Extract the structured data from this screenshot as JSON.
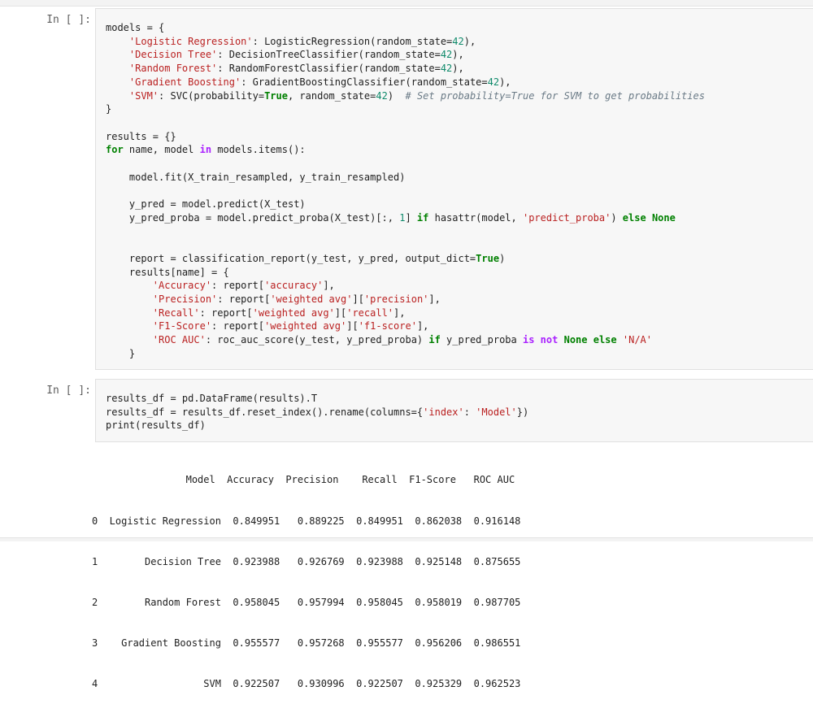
{
  "cells": [
    {
      "prompt": "In [ ]:",
      "code_lines": [
        [
          [
            "t",
            "models = {"
          ]
        ],
        [
          [
            "t",
            "    "
          ],
          [
            "s",
            "'Logistic Regression'"
          ],
          [
            "t",
            ": LogisticRegression(random_state="
          ],
          [
            "n",
            "42"
          ],
          [
            "t",
            "),"
          ]
        ],
        [
          [
            "t",
            "    "
          ],
          [
            "s",
            "'Decision Tree'"
          ],
          [
            "t",
            ": DecisionTreeClassifier(random_state="
          ],
          [
            "n",
            "42"
          ],
          [
            "t",
            "),"
          ]
        ],
        [
          [
            "t",
            "    "
          ],
          [
            "s",
            "'Random Forest'"
          ],
          [
            "t",
            ": RandomForestClassifier(random_state="
          ],
          [
            "n",
            "42"
          ],
          [
            "t",
            "),"
          ]
        ],
        [
          [
            "t",
            "    "
          ],
          [
            "s",
            "'Gradient Boosting'"
          ],
          [
            "t",
            ": GradientBoostingClassifier(random_state="
          ],
          [
            "n",
            "42"
          ],
          [
            "t",
            "),"
          ]
        ],
        [
          [
            "t",
            "    "
          ],
          [
            "s",
            "'SVM'"
          ],
          [
            "t",
            ": SVC(probability="
          ],
          [
            "k",
            "True"
          ],
          [
            "t",
            ", random_state="
          ],
          [
            "n",
            "42"
          ],
          [
            "t",
            ")  "
          ],
          [
            "c",
            "# Set probability=True for SVM to get probabilities"
          ]
        ],
        [
          [
            "t",
            "}"
          ]
        ],
        [
          [
            "t",
            ""
          ]
        ],
        [
          [
            "t",
            "results = {}"
          ]
        ],
        [
          [
            "k",
            "for"
          ],
          [
            "t",
            " name, model "
          ],
          [
            "o",
            "in"
          ],
          [
            "t",
            " models.items():"
          ]
        ],
        [
          [
            "t",
            ""
          ]
        ],
        [
          [
            "t",
            "    model.fit(X_train_resampled, y_train_resampled)"
          ]
        ],
        [
          [
            "t",
            ""
          ]
        ],
        [
          [
            "t",
            "    y_pred = model.predict(X_test)"
          ]
        ],
        [
          [
            "t",
            "    y_pred_proba = model.predict_proba(X_test)[:, "
          ],
          [
            "n",
            "1"
          ],
          [
            "t",
            "] "
          ],
          [
            "k",
            "if"
          ],
          [
            "t",
            " hasattr(model, "
          ],
          [
            "s",
            "'predict_proba'"
          ],
          [
            "t",
            ") "
          ],
          [
            "k",
            "else"
          ],
          [
            "t",
            " "
          ],
          [
            "k",
            "None"
          ]
        ],
        [
          [
            "t",
            ""
          ]
        ],
        [
          [
            "t",
            ""
          ]
        ],
        [
          [
            "t",
            "    report = classification_report(y_test, y_pred, output_dict="
          ],
          [
            "k",
            "True"
          ],
          [
            "t",
            ")"
          ]
        ],
        [
          [
            "t",
            "    results[name] = {"
          ]
        ],
        [
          [
            "t",
            "        "
          ],
          [
            "s",
            "'Accuracy'"
          ],
          [
            "t",
            ": report["
          ],
          [
            "s",
            "'accuracy'"
          ],
          [
            "t",
            "],"
          ]
        ],
        [
          [
            "t",
            "        "
          ],
          [
            "s",
            "'Precision'"
          ],
          [
            "t",
            ": report["
          ],
          [
            "s",
            "'weighted avg'"
          ],
          [
            "t",
            "]["
          ],
          [
            "s",
            "'precision'"
          ],
          [
            "t",
            "],"
          ]
        ],
        [
          [
            "t",
            "        "
          ],
          [
            "s",
            "'Recall'"
          ],
          [
            "t",
            ": report["
          ],
          [
            "s",
            "'weighted avg'"
          ],
          [
            "t",
            "]["
          ],
          [
            "s",
            "'recall'"
          ],
          [
            "t",
            "],"
          ]
        ],
        [
          [
            "t",
            "        "
          ],
          [
            "s",
            "'F1-Score'"
          ],
          [
            "t",
            ": report["
          ],
          [
            "s",
            "'weighted avg'"
          ],
          [
            "t",
            "]["
          ],
          [
            "s",
            "'f1-score'"
          ],
          [
            "t",
            "],"
          ]
        ],
        [
          [
            "t",
            "        "
          ],
          [
            "s",
            "'ROC AUC'"
          ],
          [
            "t",
            ": roc_auc_score(y_test, y_pred_proba) "
          ],
          [
            "k",
            "if"
          ],
          [
            "t",
            " y_pred_proba "
          ],
          [
            "o",
            "is"
          ],
          [
            "t",
            " "
          ],
          [
            "o",
            "not"
          ],
          [
            "t",
            " "
          ],
          [
            "k",
            "None"
          ],
          [
            "t",
            " "
          ],
          [
            "k",
            "else"
          ],
          [
            "t",
            " "
          ],
          [
            "s",
            "'N/A'"
          ]
        ],
        [
          [
            "t",
            "    }"
          ]
        ]
      ]
    },
    {
      "prompt": "In [ ]:",
      "code_lines": [
        [
          [
            "t",
            "results_df = pd.DataFrame(results).T"
          ]
        ],
        [
          [
            "t",
            "results_df = results_df.reset_index().rename(columns={"
          ],
          [
            "s",
            "'index'"
          ],
          [
            "t",
            ": "
          ],
          [
            "s",
            "'Model'"
          ],
          [
            "t",
            "})"
          ]
        ],
        [
          [
            "t",
            "print(results_df)"
          ]
        ]
      ]
    }
  ],
  "output": {
    "lines": [
      "                Model  Accuracy  Precision    Recall  F1-Score   ROC AUC",
      "0  Logistic Regression  0.849951   0.889225  0.849951  0.862038  0.916148",
      "1        Decision Tree  0.923988   0.926769  0.923988  0.925148  0.875655",
      "2        Random Forest  0.958045   0.957994  0.958045  0.958019  0.987705",
      "3    Gradient Boosting  0.955577   0.957268  0.955577  0.956206  0.986551",
      "4                  SVM  0.922507   0.930996  0.922507  0.925329  0.962523"
    ]
  }
}
